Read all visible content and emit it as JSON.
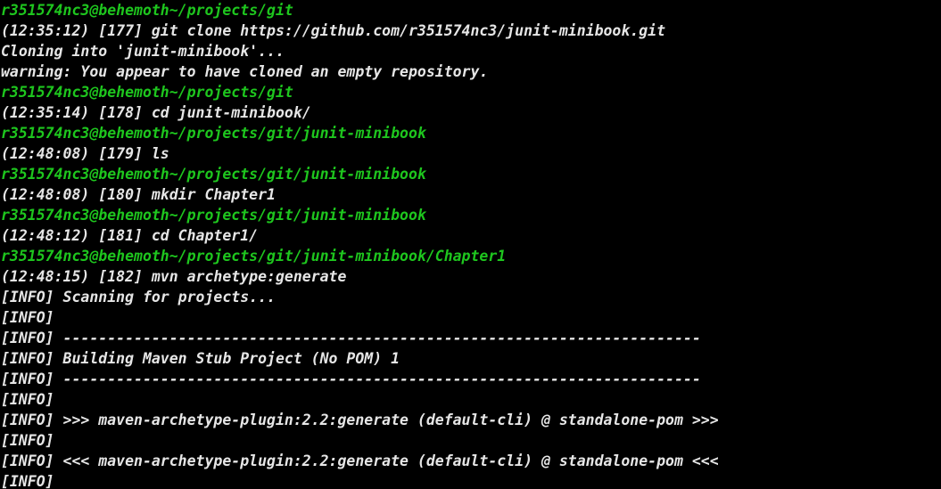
{
  "terminal": {
    "colors": {
      "background": "#000000",
      "prompt": "#1ec61e",
      "text": "#e6e6e6"
    },
    "lines": [
      {
        "kind": "prompt",
        "text": "r351574nc3@behemoth~/projects/git"
      },
      {
        "kind": "output",
        "text": "(12:35:12) [177] git clone https://github.com/r351574nc3/junit-minibook.git"
      },
      {
        "kind": "output",
        "text": "Cloning into 'junit-minibook'..."
      },
      {
        "kind": "output",
        "text": "warning: You appear to have cloned an empty repository."
      },
      {
        "kind": "prompt",
        "text": "r351574nc3@behemoth~/projects/git"
      },
      {
        "kind": "output",
        "text": "(12:35:14) [178] cd junit-minibook/"
      },
      {
        "kind": "prompt",
        "text": "r351574nc3@behemoth~/projects/git/junit-minibook"
      },
      {
        "kind": "output",
        "text": "(12:48:08) [179] ls"
      },
      {
        "kind": "prompt",
        "text": "r351574nc3@behemoth~/projects/git/junit-minibook"
      },
      {
        "kind": "output",
        "text": "(12:48:08) [180] mkdir Chapter1"
      },
      {
        "kind": "prompt",
        "text": "r351574nc3@behemoth~/projects/git/junit-minibook"
      },
      {
        "kind": "output",
        "text": "(12:48:12) [181] cd Chapter1/"
      },
      {
        "kind": "prompt",
        "text": "r351574nc3@behemoth~/projects/git/junit-minibook/Chapter1"
      },
      {
        "kind": "output",
        "text": "(12:48:15) [182] mvn archetype:generate"
      },
      {
        "kind": "output",
        "text": "[INFO] Scanning for projects..."
      },
      {
        "kind": "output",
        "text": "[INFO]"
      },
      {
        "kind": "output",
        "text": "[INFO] ------------------------------------------------------------------------"
      },
      {
        "kind": "output",
        "text": "[INFO] Building Maven Stub Project (No POM) 1"
      },
      {
        "kind": "output",
        "text": "[INFO] ------------------------------------------------------------------------"
      },
      {
        "kind": "output",
        "text": "[INFO]"
      },
      {
        "kind": "output",
        "text": "[INFO] >>> maven-archetype-plugin:2.2:generate (default-cli) @ standalone-pom >>>"
      },
      {
        "kind": "output",
        "text": "[INFO]"
      },
      {
        "kind": "output",
        "text": "[INFO] <<< maven-archetype-plugin:2.2:generate (default-cli) @ standalone-pom <<<"
      },
      {
        "kind": "output",
        "text": "[INFO]"
      }
    ]
  }
}
